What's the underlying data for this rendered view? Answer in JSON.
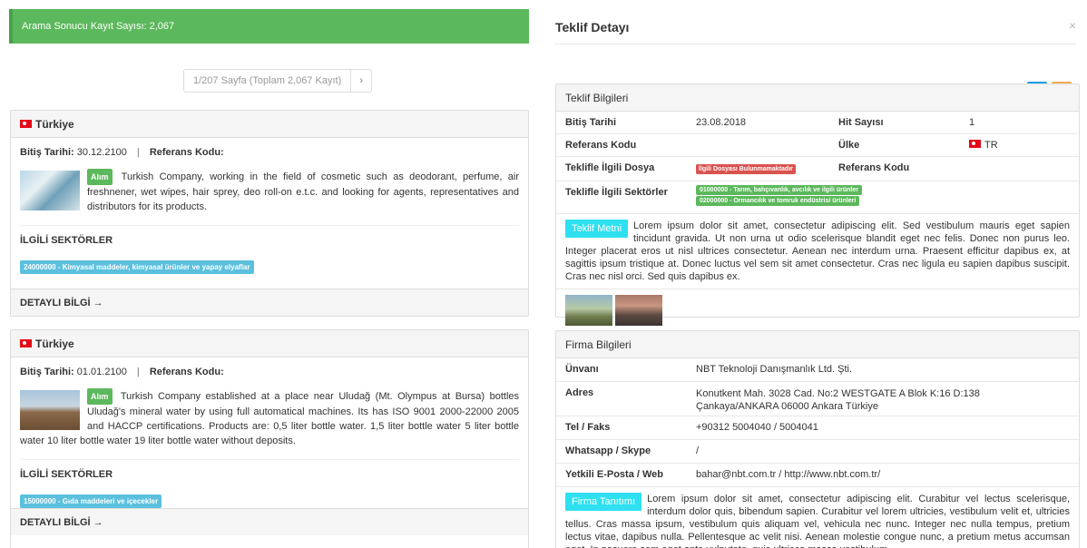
{
  "left": {
    "result_count": "Arama Sonucu Kayıt Sayısı: 2,067",
    "pager": {
      "info": "1/207 Sayfa (Toplam 2,067 Kayıt)",
      "next": "›"
    },
    "cards": [
      {
        "country": "Türkiye",
        "end_label": "Bitiş Tarihi:",
        "end_date": "30.12.2100",
        "sep": "|",
        "ref_label": "Referans Kodu:",
        "badge": "Alım",
        "description": "Turkish Company, working in the field of cosmetic such as deodorant, perfume, air freshnener, wet wipes, hair sprey, deo roll-on e.t.c. and looking for agents, representatives and distributors for its products.",
        "sectors_title": "İLGİLİ SEKTÖRLER",
        "sector_tag": "24000000 - Kimyasal maddeler, kimyasal ürünler ve yapay elyaflar",
        "footer": "DETAYLI BİLGİ →"
      },
      {
        "country": "Türkiye",
        "end_label": "Bitiş Tarihi:",
        "end_date": "01.01.2100",
        "sep": "|",
        "ref_label": "Referans Kodu:",
        "badge": "Alım",
        "description": "Turkish Company established at a place near Uludağ (Mt. Olympus at Bursa) bottles Uludağ's mineral water by using full automatical machines. Its has ISO 9001 2000-22000 2005 and HACCP certifications. Products are: 0,5 liter bottle water. 1,5 liter bottle water 5 liter bottle water 10 liter bottle water 19 liter bottle water without deposits.",
        "sectors_title": "İLGİLİ SEKTÖRLER",
        "sector_tag": "15000000 - Gıda maddeleri ve içecekler",
        "footer": "DETAYLI BİLGİ →"
      }
    ]
  },
  "modal": {
    "title": "Teklif Detayı",
    "close": "×",
    "twitter_icon": "twitter-icon",
    "print_icon": "print-icon",
    "teklif": {
      "heading": "Teklif Bilgileri",
      "end_label": "Bitiş Tarihi",
      "end_value": "23.08.2018",
      "hit_label": "Hit Sayısı",
      "hit_value": "1",
      "ref_label": "Referans Kodu",
      "ref_value": "",
      "country_label": "Ülke",
      "country_value": "TR",
      "file_label": "Teklifle İlgili Dosya",
      "file_badge": "İlgili Dosyası Bulunmamaktadır",
      "ref2_label": "Referans Kodu",
      "sectors_label": "Teklifle İlgili Sektörler",
      "sector_1": "01000000 - Tarım, bahçıvanlık, avcılık ve ilgili ürünler",
      "sector_2": "02000000 - Ormancılık ve tomruk endüstrisi ürünleri",
      "text_tag": "Teklif Metni",
      "text": "Lorem ipsum dolor sit amet, consectetur adipiscing elit. Sed vestibulum mauris eget sapien tincidunt gravida. Ut non urna ut odio scelerisque blandit eget nec felis. Donec non purus leo. Integer placerat eros ut nisl ultrices consectetur. Aenean nec interdum urna. Praesent efficitur dapibus ex, at sagittis ipsum tristique at. Donec luctus vel sem sit amet consectetur. Cras nec ligula eu sapien dapibus suscipit. Cras nec nisl orci. Sed quis dapibus ex."
    },
    "firma": {
      "heading": "Firma Bilgileri",
      "unvan_label": "Ünvanı",
      "unvan_value": "NBT Teknoloji Danışmanlık Ltd. Şti.",
      "adres_label": "Adres",
      "adres_value": "Konutkent Mah. 3028 Cad. No:2 WESTGATE A Blok K:16 D:138 Çankaya/ANKARA  06000 Ankara  Türkiye",
      "tel_label": "Tel / Faks",
      "tel_value": "+90312 5004040 / 5004041",
      "wa_label": "Whatsapp / Skype",
      "wa_value": "/",
      "mail_label": "Yetkili E-Posta / Web",
      "mail_value": "bahar@nbt.com.tr / http://www.nbt.com.tr/",
      "text_tag": "Firma Tanıtımı",
      "text": "Lorem ipsum dolor sit amet, consectetur adipiscing elit. Curabitur vel lectus scelerisque, interdum dolor quis, bibendum sapien. Curabitur vel lorem ultricies, vestibulum velit et, ultricies tellus. Cras massa ipsum, vestibulum quis aliquam vel, vehicula nec nunc. Integer nec nulla tempus, pretium lectus vitae, dapibus nulla. Pellentesque ac velit nisi. Aenean molestie congue nunc, a pretium metus accumsan eget. In posuere sem eget ante vulputate, quis ultrices massa vestibulum."
    }
  }
}
